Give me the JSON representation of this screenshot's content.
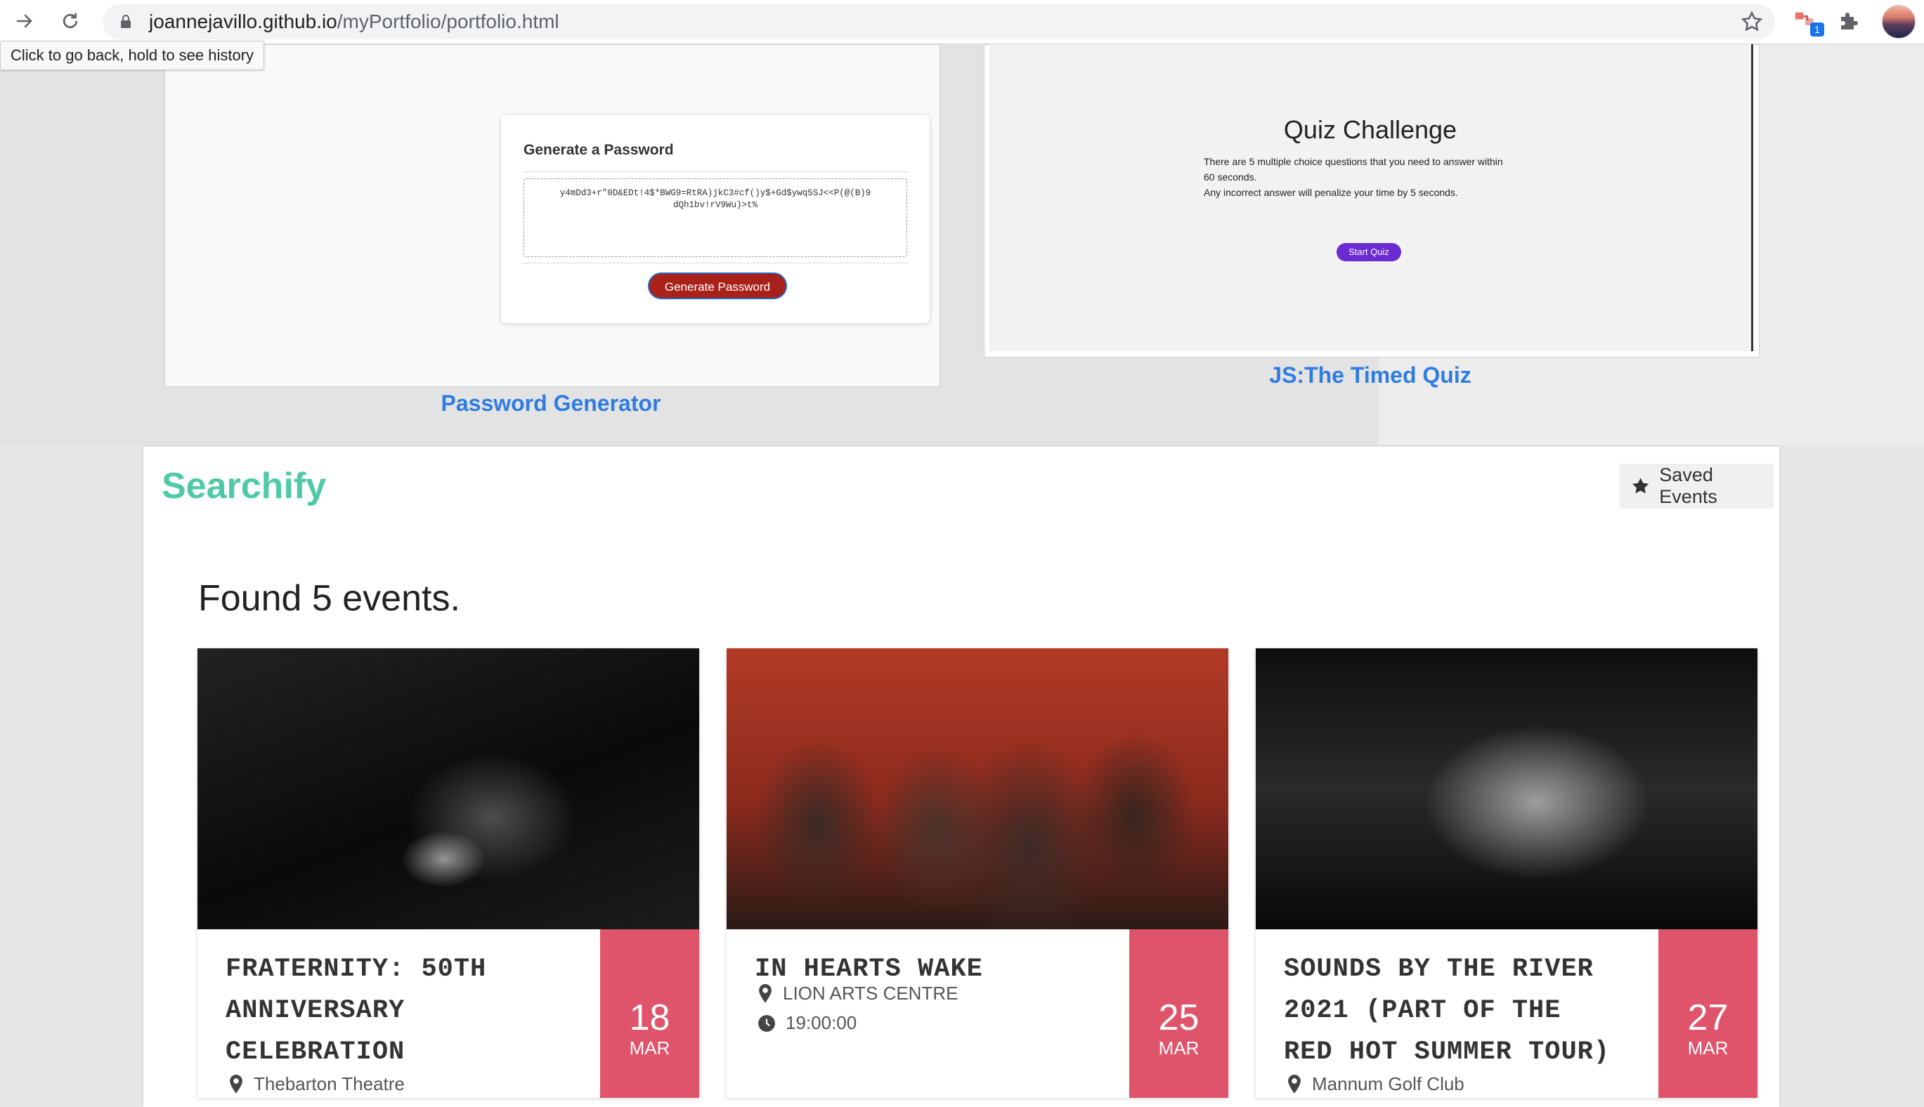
{
  "browser": {
    "url_host": "joannejavillo.github.io",
    "url_path": "/myPortfolio/portfolio.html",
    "tooltip": "Click to go back, hold to see history",
    "extension_badge": "1"
  },
  "portfolio": {
    "password_project": {
      "card_title": "Generate a Password",
      "password_value": "y4mDd3+r\"0D&EDt!4$*BWG9=RtRA)jkC3#cf()y$+Gd$ywq5SJ<<P(@(B)9 dQh1bv!rV9Wu)>t%",
      "button_label": "Generate Password",
      "link_label": "Password Generator"
    },
    "quiz_project": {
      "title": "Quiz Challenge",
      "description_line1": "There are 5 multiple choice questions that you need to answer within",
      "description_line2": "60 seconds.",
      "description_line3": "Any incorrect answer will penalize your time by 5 seconds.",
      "button_label": "Start Quiz",
      "link_label": "JS:The Timed Quiz"
    }
  },
  "searchify": {
    "brand": "Searchify",
    "saved_events_label": "Saved Events",
    "found_text": "Found 5 events.",
    "events": [
      {
        "name_line1": "FRATERNITY: 50TH",
        "name_line2": "ANNIVERSARY",
        "name_line3": "CELEBRATION",
        "venue": "Thebarton Theatre",
        "day": "18",
        "month": "MAR"
      },
      {
        "name_line1": "IN HEARTS WAKE",
        "venue": "LION ARTS CENTRE",
        "time": "19:00:00",
        "day": "25",
        "month": "MAR"
      },
      {
        "name_line1": "SOUNDS BY THE RIVER",
        "name_line2": "2021 (PART OF THE",
        "name_line3": "RED HOT SUMMER TOUR)",
        "venue": "Mannum Golf Club",
        "day": "27",
        "month": "MAR"
      }
    ]
  },
  "colors": {
    "brand": "#4fc9a8",
    "date_badge": "#e0546b",
    "project_link": "#2f7de1",
    "password_button": "#a8211a",
    "quiz_button": "#6a2bd0"
  },
  "icons": [
    "back-arrow-icon",
    "reload-icon",
    "lock-icon",
    "bookmark-star-icon",
    "extension-icon",
    "puzzle-icon",
    "star-icon",
    "map-pin-icon",
    "clock-icon"
  ]
}
